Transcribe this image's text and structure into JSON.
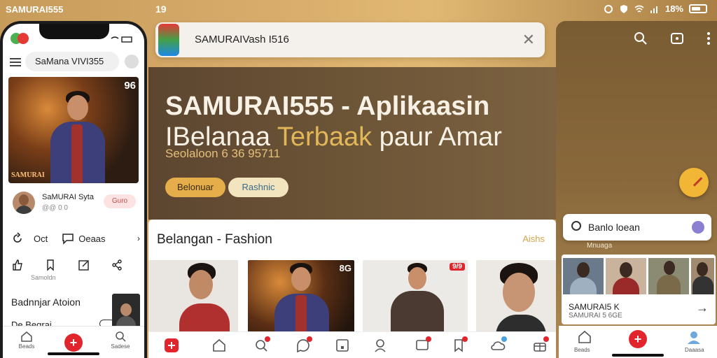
{
  "status_bar": {
    "brand": "SAMURAI555",
    "time": "19",
    "battery": "18%"
  },
  "phone": {
    "search": "SaMana VIVI355",
    "hero_number": "96",
    "hero_logo": "SAMURAI",
    "profile_name": "SaMURAI Syta",
    "profile_sub": "@@ 0 0",
    "follow_label": "Guro",
    "action_left": "Oct",
    "action_right": "Oeaas",
    "icon_caption": "Samoldn",
    "list_title": "Badnnjar Atoion",
    "list_sub": "De Begrai",
    "nav_labels": [
      "Beads",
      "",
      "Sadese"
    ]
  },
  "search_bar": {
    "text": "SAMURAIVash I516"
  },
  "hero": {
    "title_line1": "SAMURAI555 - Aplikaasin",
    "title_line2_a": "IBelanaa ",
    "title_line2_gold": "Terbaak",
    "title_line2_b": " paur Amar",
    "subtitle": "Seolaloon 6 36 95711",
    "btn_primary": "Belonuar",
    "btn_secondary": "Rashnic"
  },
  "section": {
    "heading": "Belangan - Fashion",
    "see_all": "Aishs",
    "tags": [
      "",
      "8G",
      "9/9",
      ""
    ]
  },
  "right_panel": {
    "search_query": "Banlo loean",
    "caption": "Mnuaga",
    "card_title": "SAMURAI5 K",
    "card_sub": "SAMURAI 5 6GE",
    "nav_labels": [
      "Beads",
      "Daaasa"
    ]
  },
  "colors": {
    "accent_red": "#e0262c",
    "gold": "#e2b759",
    "hero_bg": "#5d4630"
  }
}
